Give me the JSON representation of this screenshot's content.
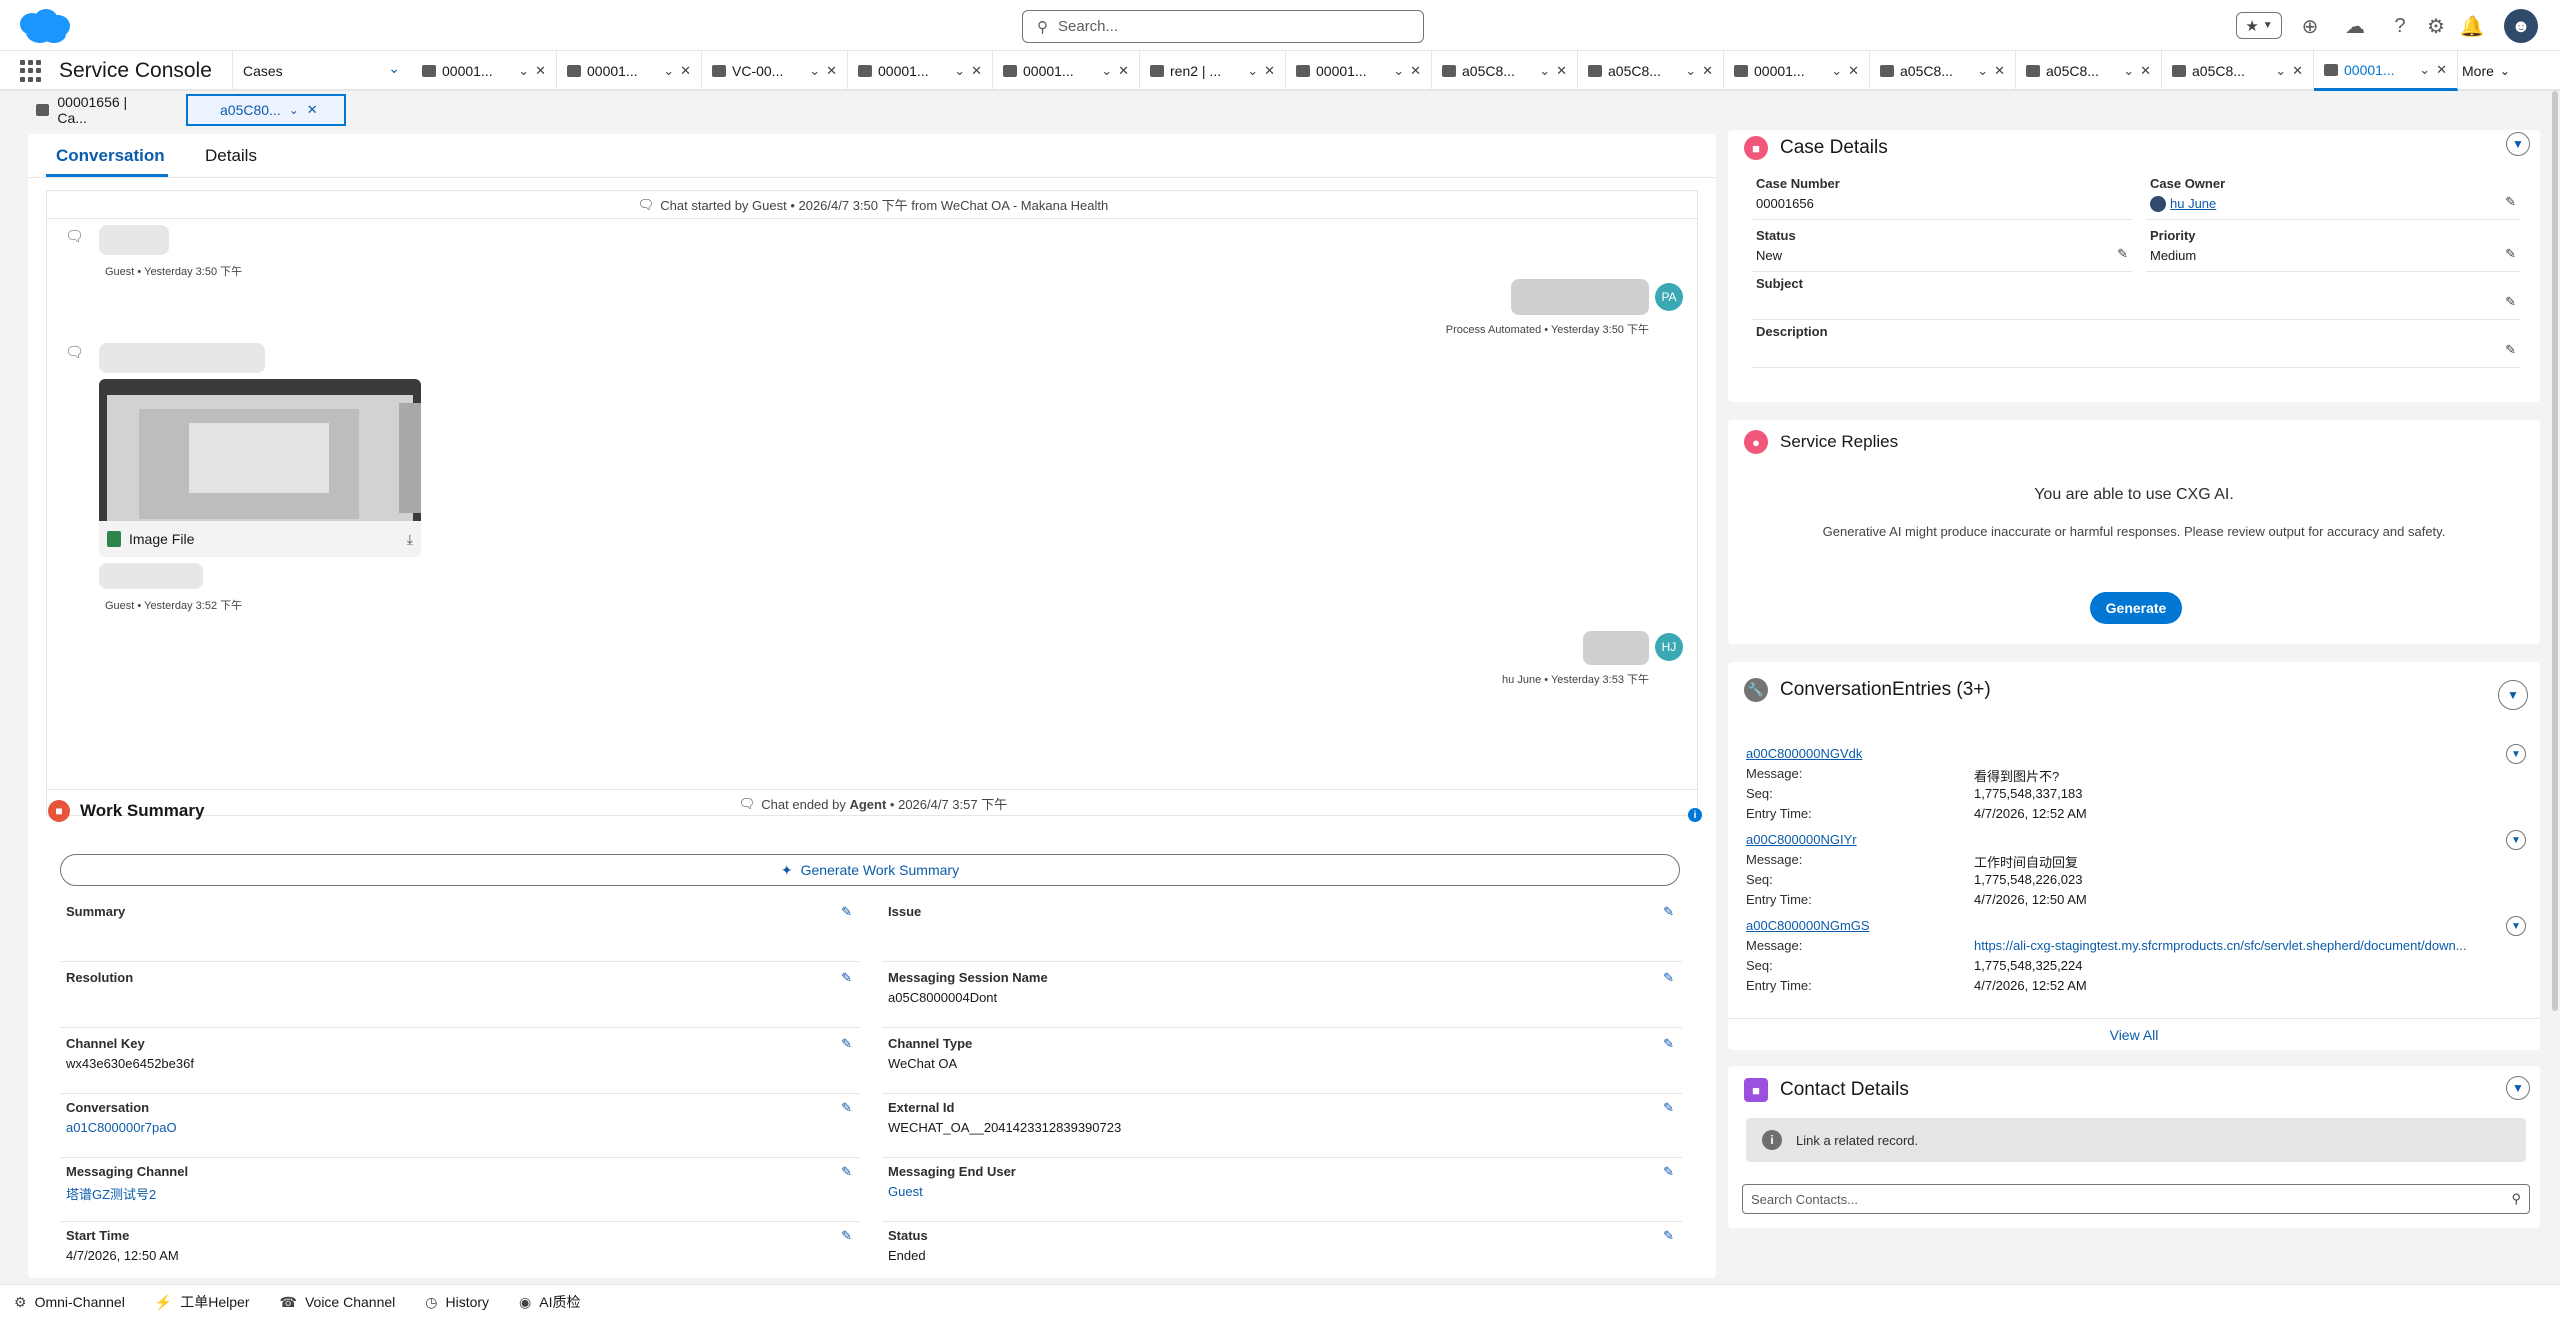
{
  "header": {
    "search_placeholder": "Search...",
    "icons": [
      "favorites-icon",
      "add-icon",
      "trailhead-icon",
      "help-icon",
      "setup-icon",
      "notifications-icon"
    ]
  },
  "nav": {
    "app_name": "Service Console",
    "object_nav_label": "Cases",
    "tabs": [
      {
        "label": "00001..."
      },
      {
        "label": "00001..."
      },
      {
        "label": "VC-00..."
      },
      {
        "label": "00001..."
      },
      {
        "label": "00001..."
      },
      {
        "label": "ren2 | ..."
      },
      {
        "label": "00001..."
      },
      {
        "label": "a05C8..."
      },
      {
        "label": "a05C8..."
      },
      {
        "label": "00001..."
      },
      {
        "label": "a05C8..."
      },
      {
        "label": "a05C8..."
      },
      {
        "label": "a05C8..."
      },
      {
        "label": "00001..."
      }
    ],
    "more_label": "More"
  },
  "subtabs": [
    {
      "label": "00001656 | Ca..."
    },
    {
      "label": "a05C80..."
    }
  ],
  "conversation": {
    "tab_conversation": "Conversation",
    "tab_details": "Details",
    "chat_start_prefix": "Chat started by Guest • 2026/4/7 3:50 下午 from WeChat OA - Makana Health",
    "msg1_meta": "Guest • Yesterday 3:50 下午",
    "msg2_meta": "Process Automated • Yesterday 3:50 下午",
    "msg2_avatar": "PA",
    "image_file_label": "Image File",
    "msg3_meta": "Guest • Yesterday 3:52 下午",
    "msg4_meta": "hu June • Yesterday 3:53 下午",
    "msg4_avatar": "HJ",
    "chat_end_prefix": "Chat ended by ",
    "chat_end_agent": "Agent",
    "chat_end_suffix": " • 2026/4/7 3:57 下午"
  },
  "work_summary": {
    "title": "Work Summary",
    "generate_label": "Generate Work Summary",
    "fields_left": [
      {
        "label": "Summary",
        "value": ""
      },
      {
        "label": "Resolution",
        "value": ""
      },
      {
        "label": "Channel Key",
        "value": "wx43e630e6452be36f"
      },
      {
        "label": "Conversation",
        "value": "a01C800000r7paO"
      },
      {
        "label": "Messaging Channel",
        "value": "塔谱GZ测试号2"
      },
      {
        "label": "Start Time",
        "value": "4/7/2026, 12:50 AM"
      }
    ],
    "fields_right": [
      {
        "label": "Issue",
        "value": ""
      },
      {
        "label": "Messaging Session Name",
        "value": "a05C8000004Dont"
      },
      {
        "label": "Channel Type",
        "value": "WeChat OA"
      },
      {
        "label": "External Id",
        "value": "WECHAT_OA__2041423312839390723"
      },
      {
        "label": "Messaging End User",
        "value": "Guest"
      },
      {
        "label": "Status",
        "value": "Ended"
      }
    ]
  },
  "case_details": {
    "title": "Case Details",
    "case_number_label": "Case Number",
    "case_number": "00001656",
    "case_owner_label": "Case Owner",
    "case_owner": "hu June",
    "status_label": "Status",
    "status": "New",
    "priority_label": "Priority",
    "priority": "Medium",
    "subject_label": "Subject",
    "description_label": "Description"
  },
  "service_replies": {
    "title": "Service Replies",
    "headline": "You are able to use CXG AI.",
    "disclaimer": "Generative AI might produce inaccurate or harmful responses. Please review output for accuracy and safety.",
    "generate_label": "Generate"
  },
  "conversation_entries": {
    "title": "ConversationEntries (3+)",
    "message_label": "Message:",
    "seq_label": "Seq:",
    "entry_time_label": "Entry Time:",
    "entries": [
      {
        "id": "a00C800000NGVdk",
        "message": "看得到图片不?",
        "seq": "1,775,548,337,183",
        "entry_time": "4/7/2026, 12:52 AM"
      },
      {
        "id": "a00C800000NGIYr",
        "message": "工作时间自动回复",
        "seq": "1,775,548,226,023",
        "entry_time": "4/7/2026, 12:50 AM"
      },
      {
        "id": "a00C800000NGmGS",
        "message": "https://ali-cxg-stagingtest.my.sfcrmproducts.cn/sfc/servlet.shepherd/document/down...",
        "seq": "1,775,548,325,224",
        "entry_time": "4/7/2026, 12:52 AM"
      }
    ],
    "view_all": "View All"
  },
  "contact_details": {
    "title": "Contact Details",
    "link_prompt": "Link a related record.",
    "search_placeholder": "Search Contacts..."
  },
  "utility_bar": [
    {
      "label": "Omni-Channel"
    },
    {
      "label": "工单Helper"
    },
    {
      "label": "Voice Channel"
    },
    {
      "label": "History"
    },
    {
      "label": "AI质检"
    }
  ],
  "colors": {
    "brand_blue": "#0176d3",
    "link_blue": "#0b5cab",
    "agent_avatar": "#3ba9b4"
  }
}
